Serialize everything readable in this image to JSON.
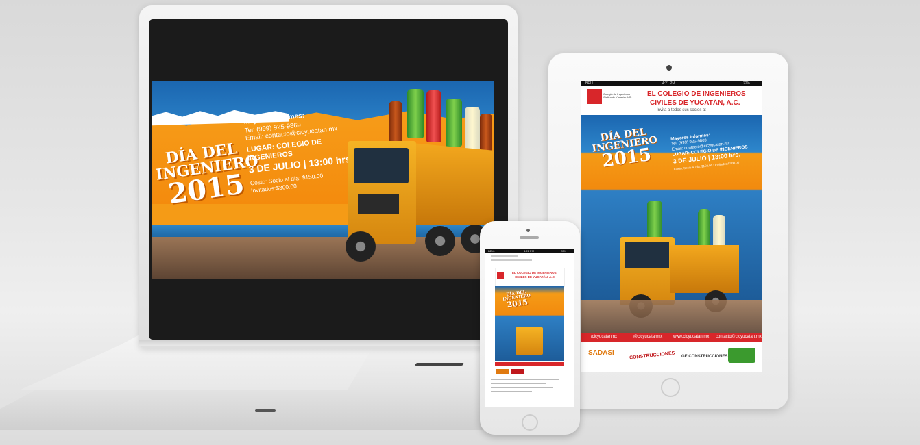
{
  "banner": {
    "title_line1": "DÍA DEL",
    "title_line2": "INGENIERO",
    "title_line3": "2015",
    "info_heading": "Mayores Informes:",
    "tel": "Tel: (999) 925-9869",
    "email": "Email: contacto@cicyucatan.mx",
    "lugar": "LUGAR: COLEGIO DE INGENIEROS",
    "date_time": "3 DE JULIO | 13:00 hrs.",
    "costo": "Costo: Socio al día: $150.00",
    "invitados": "Invitados:$300.00"
  },
  "tablet": {
    "status_carrier": "BELL",
    "status_time": "4:21 PM",
    "status_battery": "22%",
    "org_line1": "EL COLEGIO DE INGENIEROS",
    "org_line2": "CIVILES DE YUCATÁN, A.C.",
    "logo_text": "Colegio de Ingenieros Civiles de Yucatán A.C.",
    "invite": "Invita a todos sus socios a:",
    "title_line1": "DÍA DEL",
    "title_line2": "INGENIERO",
    "title_line3": "2015",
    "info_heading": "Mayores Informes:",
    "tel": "Tel: (999) 925-9869",
    "email": "Email: contacto@cicyucatan.mx",
    "lugar": "LUGAR: COLEGIO DE INGENIEROS",
    "date_time": "3 DE JULIO | 13:00 hrs.",
    "costo": "Costo: Socio al día: $150.00 | Invitados:$300.00",
    "social_fb": "/cicyucatanmx",
    "social_tw": "@cicyucatanmx",
    "social_web": "www.cicyucatan.mx",
    "social_mail": "contacto@cicyucatan.mx",
    "sponsor1": "SADASI",
    "sponsor2": "CONSTRUCCIONES",
    "sponsor3": "GE CONSTRUCCIONES"
  },
  "phone": {
    "status_carrier": "BELL",
    "status_time": "4:21 PM",
    "status_battery": "22%",
    "org_line1": "EL COLEGIO DE INGENIEROS",
    "org_line2": "CIVILES DE YUCATÁN, A.C.",
    "title_line1": "DÍA DEL",
    "title_line2": "INGENIERO",
    "title_line3": "2015"
  },
  "colors": {
    "orange": "#f59b16",
    "blue": "#1b66b0",
    "red": "#d8262a"
  }
}
